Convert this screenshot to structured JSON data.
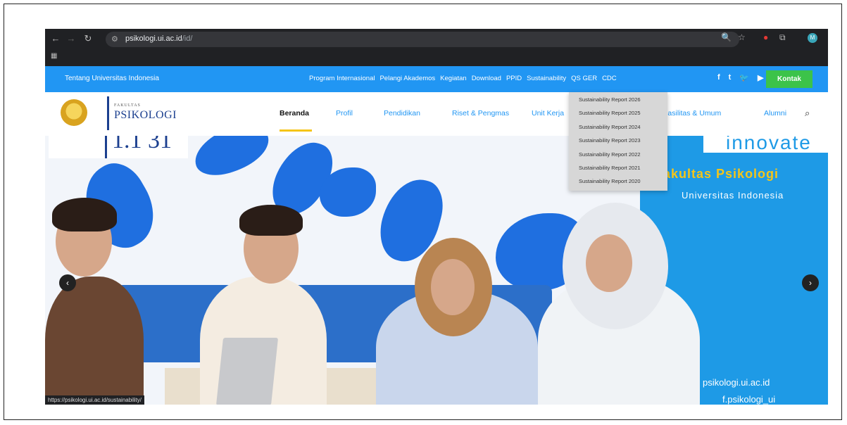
{
  "browser": {
    "url_host": "psikologi.ui.ac.id",
    "url_path": "/id/",
    "profile_initial": "M",
    "status_url": "https://psikologi.ui.ac.id/sustainability/"
  },
  "topbar": {
    "about": "Tentang Universitas Indonesia",
    "menu": [
      "Program Internasional",
      "Pelangi Akademos",
      "Kegiatan",
      "Download",
      "PPID",
      "Sustainability",
      "QS GER",
      "CDC"
    ],
    "social": [
      "f",
      "t",
      "🐦",
      "▶",
      "◎"
    ],
    "contact": "Kontak"
  },
  "logo": {
    "small": "FAKULTAS",
    "name": "PSIKOLOGI"
  },
  "nav": {
    "items": [
      "Beranda",
      "Profil",
      "Pendidikan",
      "Riset & Pengmas",
      "Unit Kerja",
      "Fasilitas & Umum",
      "Alumni"
    ]
  },
  "dropdown": {
    "items": [
      "Sustainability Report 2026",
      "Sustainability Report 2025",
      "Sustainability Report 2024",
      "Sustainability Report 2023",
      "Sustainability Report 2022",
      "Sustainability Report 2021",
      "Sustainability Report 2020"
    ]
  },
  "hero": {
    "innovate": "innovate",
    "faculty": "akultas Psikologi",
    "university": "Universitas Indonesia",
    "website": "psikologi.ui.ac.id",
    "instagram": "f.psikologi_ui",
    "mark": "1.1 31"
  },
  "colors": {
    "brand_blue": "#2196f3",
    "accent_yellow": "#f5c518",
    "contact_green": "#3cc34a"
  }
}
